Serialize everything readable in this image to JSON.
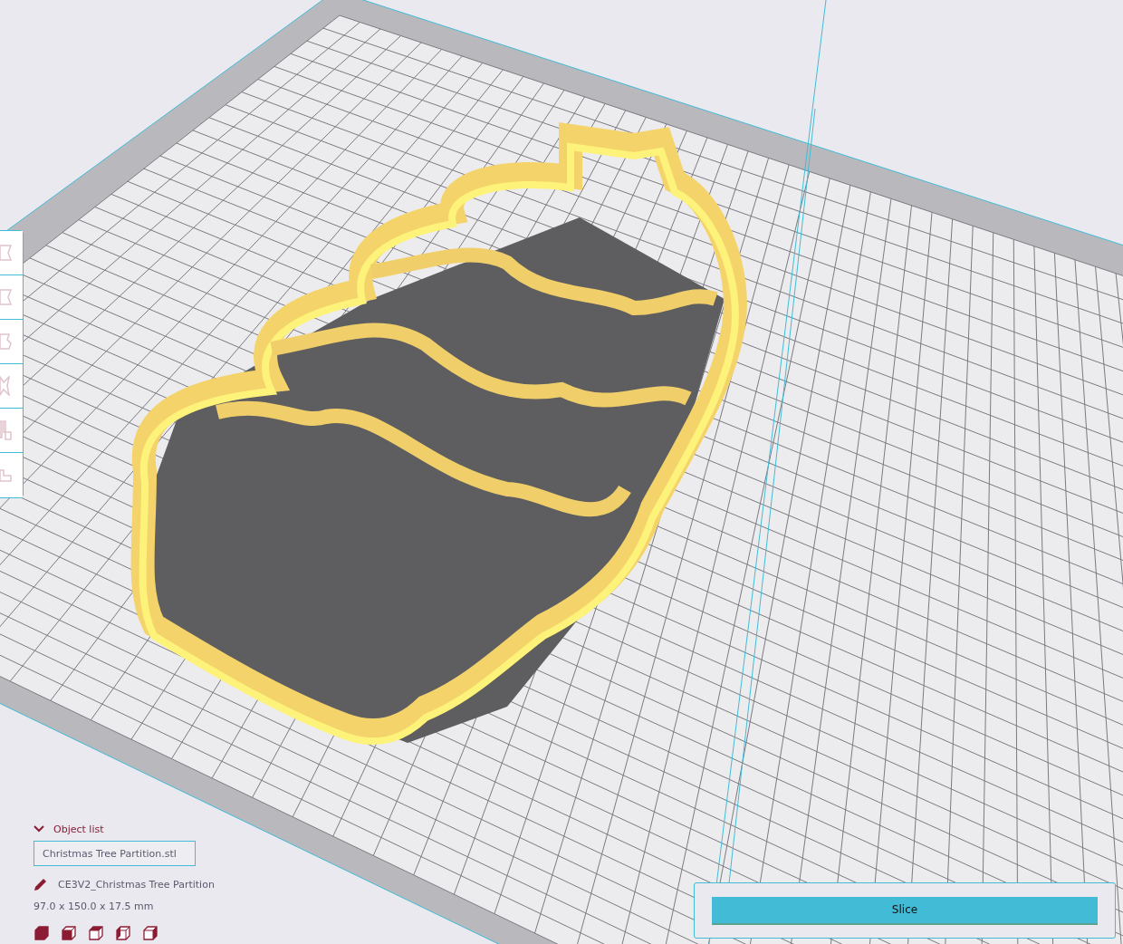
{
  "object_list": {
    "title": "Object list",
    "expanded": true,
    "file": "Christmas Tree Partition.stl",
    "job_name": "CE3V2_Christmas Tree Partition",
    "dimensions": "97.0 x 150.0 x 17.5 mm"
  },
  "slice_button": {
    "label": "Slice"
  }
}
